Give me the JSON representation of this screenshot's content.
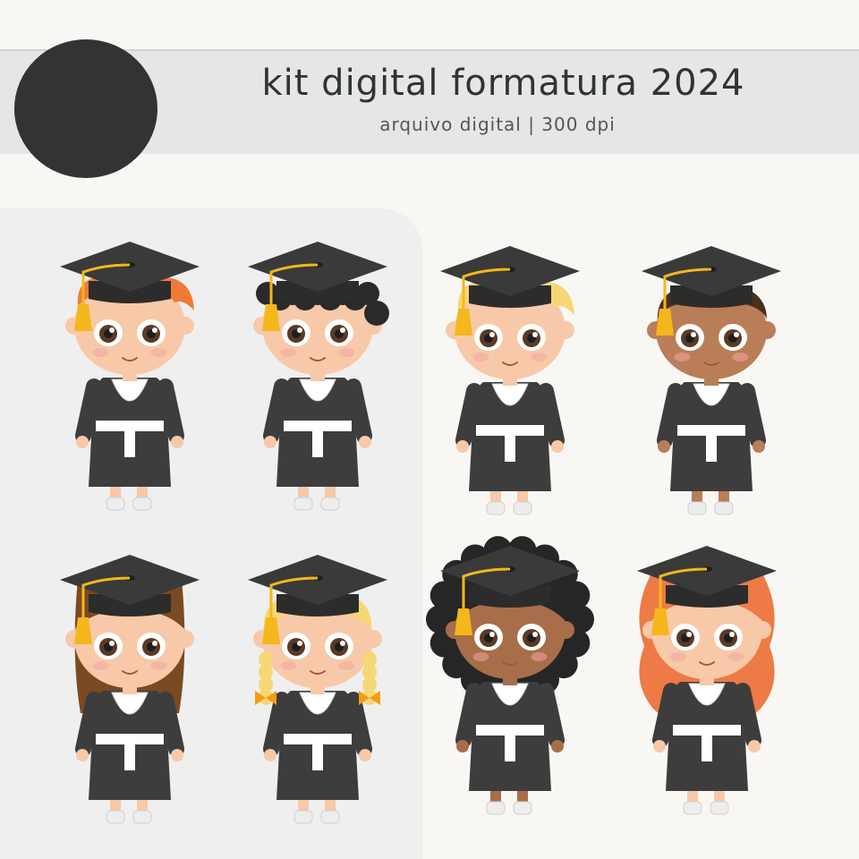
{
  "header": {
    "title": "kit digital formatura 2024",
    "subtitle": "arquivo digital | 300 dpi"
  },
  "colors": {
    "background": "#f9f7f4",
    "banner": "#e6e6e6",
    "panel": "#efefef",
    "logo": "#333333",
    "gown": "#3d3d3d",
    "cap": "#3a3a3a",
    "tassel": "#f4b71c"
  },
  "graduates": [
    {
      "name": "graduate-boy-ginger",
      "kind": "boy",
      "skin": "#f7c9a8",
      "hair": "#f07a35",
      "style": "boy-spiky"
    },
    {
      "name": "graduate-boy-curly",
      "kind": "boy",
      "skin": "#f7c9a8",
      "hair": "#2a2a2a",
      "style": "boy-curly"
    },
    {
      "name": "graduate-boy-blond",
      "kind": "boy",
      "skin": "#f7c9a8",
      "hair": "#f7d774",
      "style": "boy-spiky"
    },
    {
      "name": "graduate-boy-dark-skin",
      "kind": "boy",
      "skin": "#b97e57",
      "hair": "#4a2f1c",
      "style": "boy-short"
    },
    {
      "name": "graduate-girl-brown-hair",
      "kind": "girl",
      "skin": "#f7c9a8",
      "hair": "#7a4a22",
      "style": "girl-straight"
    },
    {
      "name": "graduate-girl-blonde-braids",
      "kind": "girl",
      "skin": "#f7c9a8",
      "hair": "#f7d774",
      "style": "girl-braids",
      "bow": "#f59b16"
    },
    {
      "name": "graduate-girl-curly-afro",
      "kind": "girl",
      "skin": "#a86e49",
      "hair": "#262626",
      "style": "girl-afro"
    },
    {
      "name": "graduate-girl-red-hair",
      "kind": "girl",
      "skin": "#f7c9a8",
      "hair": "#ee7a45",
      "style": "girl-wavy"
    }
  ]
}
